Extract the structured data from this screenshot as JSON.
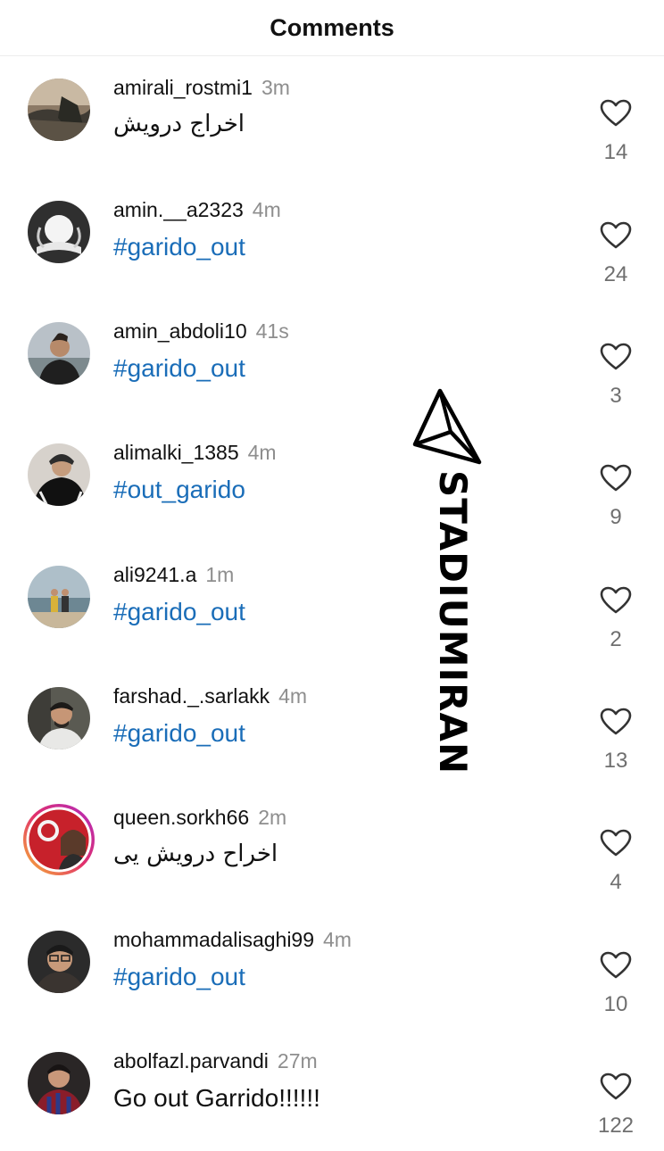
{
  "header": {
    "title": "Comments"
  },
  "watermark": {
    "text": "STADIUMIRAN"
  },
  "comments": [
    {
      "username": "amirali_rostmi1",
      "time": "3m",
      "text": "اخراج درویش",
      "likes": "14",
      "style": "rtl",
      "avatar": "landscape-photo"
    },
    {
      "username": "amin.__a2323",
      "time": "4m",
      "text": "#garido_out",
      "likes": "24",
      "style": "tag",
      "avatar": "emblem-photo"
    },
    {
      "username": "amin_abdoli10",
      "time": "41s",
      "text": "#garido_out",
      "likes": "3",
      "style": "tag",
      "avatar": "man-photo"
    },
    {
      "username": "alimalki_1385",
      "time": "4m",
      "text": "#out_garido",
      "likes": "9",
      "style": "tag",
      "avatar": "man-hoodie-photo"
    },
    {
      "username": "ali9241.a",
      "time": "1m",
      "text": "#garido_out",
      "likes": "2",
      "style": "tag",
      "avatar": "couple-beach-photo"
    },
    {
      "username": "farshad._.sarlakk",
      "time": "4m",
      "text": "#garido_out",
      "likes": "13",
      "style": "tag",
      "avatar": "man-car-photo"
    },
    {
      "username": "queen.sorkh66",
      "time": "2m",
      "text": "اخراح درویش یی",
      "likes": "4",
      "style": "rtl",
      "avatar": "woman-red-photo"
    },
    {
      "username": "mohammadalisaghi99",
      "time": "4m",
      "text": "#garido_out",
      "likes": "10",
      "style": "tag",
      "avatar": "man-glasses-photo"
    },
    {
      "username": "abolfazl.parvandi",
      "time": "27m",
      "text": "Go out Garrido!!!!!!",
      "likes": "122",
      "style": "plain",
      "avatar": "man-jersey-photo"
    }
  ]
}
